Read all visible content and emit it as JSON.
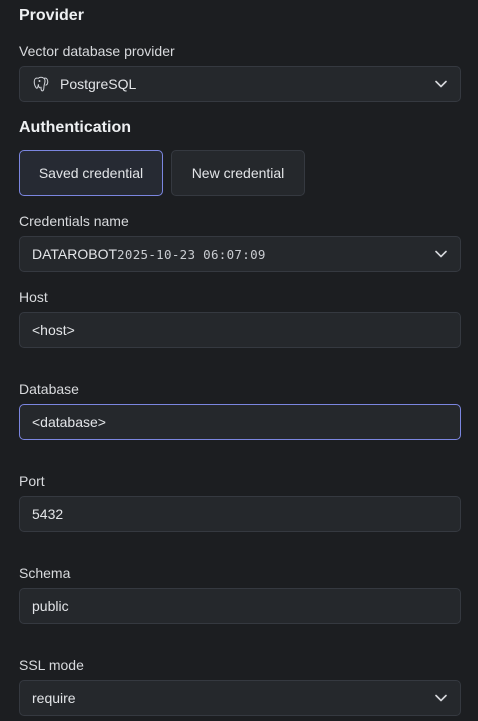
{
  "provider": {
    "section_title": "Provider",
    "label": "Vector database provider",
    "selected": "PostgreSQL",
    "icon": "postgresql-elephant-icon"
  },
  "authentication": {
    "section_title": "Authentication",
    "tabs": [
      {
        "label": "Saved credential",
        "active": true
      },
      {
        "label": "New credential",
        "active": false
      }
    ],
    "credentials_label": "Credentials name",
    "credentials_name": "DATAROBOT",
    "credentials_timestamp": "2025-10-23 06:07:09"
  },
  "fields": {
    "host": {
      "label": "Host",
      "value": "<host>"
    },
    "database": {
      "label": "Database",
      "value": "<database>"
    },
    "port": {
      "label": "Port",
      "value": "5432"
    },
    "schema": {
      "label": "Schema",
      "value": "public"
    },
    "ssl_mode": {
      "label": "SSL mode",
      "value": "require"
    }
  },
  "colors": {
    "background": "#1c1e21",
    "field": "#25282c",
    "focus_border": "#7b86e0"
  }
}
